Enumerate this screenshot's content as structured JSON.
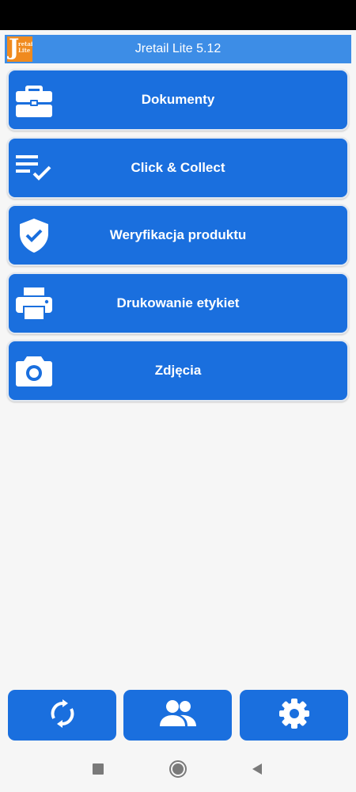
{
  "app": {
    "title": "Jretail Lite 5.12",
    "logo_letter": "J",
    "logo_small": "retail Lite"
  },
  "menu": [
    {
      "label": "Dokumenty",
      "icon": "briefcase-icon"
    },
    {
      "label": "Click & Collect",
      "icon": "checklist-icon"
    },
    {
      "label": "Weryfikacja produktu",
      "icon": "shield-check-icon"
    },
    {
      "label": "Drukowanie etykiet",
      "icon": "printer-icon"
    },
    {
      "label": "Zdjęcia",
      "icon": "camera-icon"
    }
  ],
  "bottom_bar": [
    {
      "icon": "sync-icon"
    },
    {
      "icon": "users-icon"
    },
    {
      "icon": "gear-icon"
    }
  ],
  "nav": [
    {
      "icon": "recents-square-icon"
    },
    {
      "icon": "home-circle-icon"
    },
    {
      "icon": "back-triangle-icon"
    }
  ],
  "colors": {
    "button": "#1a6fde",
    "header": "#3d8de6",
    "logo": "#f08a1e",
    "background": "#f6f6f6"
  }
}
